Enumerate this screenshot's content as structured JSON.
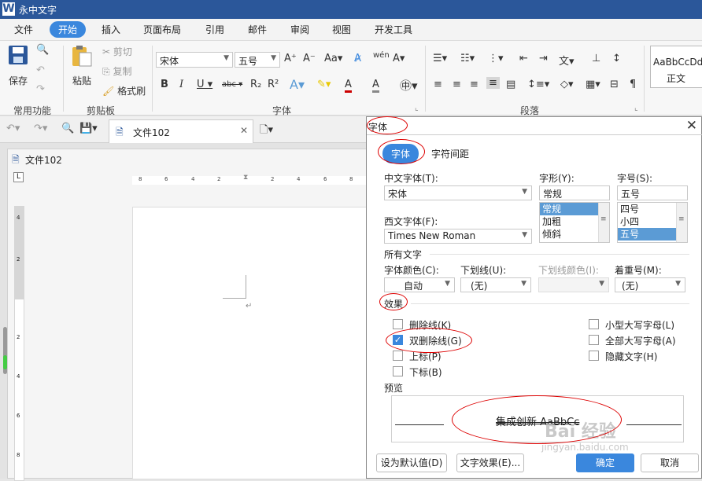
{
  "app": {
    "title": "永中文字",
    "logo": "W"
  },
  "menu": [
    "文件",
    "开始",
    "插入",
    "页面布局",
    "引用",
    "邮件",
    "审阅",
    "视图",
    "开发工具"
  ],
  "ribbon": {
    "save": "保存",
    "group_common": "常用功能",
    "paste": "粘贴",
    "cut": "剪切",
    "copy": "复制",
    "format_painter": "格式刷",
    "group_clipboard": "剪贴板",
    "font_name": "宋体",
    "font_size": "五号",
    "group_font": "字体",
    "group_paragraph": "段落",
    "style_sample": "AaBbCcDd",
    "style_name": "正文"
  },
  "doc": {
    "tab": "文件102",
    "area_title": "文件102",
    "ruler_h": [
      "8",
      "6",
      "4",
      "2",
      "2",
      "4",
      "6",
      "8"
    ],
    "ruler_v": [
      "4",
      "2",
      "2",
      "4",
      "6",
      "8"
    ]
  },
  "dialog": {
    "title": "字体",
    "tab_font": "字体",
    "tab_spacing": "字符间距",
    "cn_font_label": "中文字体(T):",
    "cn_font": "宋体",
    "style_label": "字形(Y):",
    "style_value": "常规",
    "style_list": [
      "常规",
      "加粗",
      "倾斜"
    ],
    "size_label": "字号(S):",
    "size_value": "五号",
    "size_list": [
      "四号",
      "小四",
      "五号"
    ],
    "west_font_label": "西文字体(F):",
    "west_font": "Times New Roman",
    "all_text": "所有文字",
    "color_label": "字体颜色(C):",
    "color_value": "自动",
    "underline_label": "下划线(U):",
    "underline_value": "(无)",
    "underline_color_label": "下划线颜色(I):",
    "emphasis_label": "着重号(M):",
    "emphasis_value": "(无)",
    "effects": "效果",
    "strike": "删除线(K)",
    "double_strike": "双删除线(G)",
    "superscript": "上标(P)",
    "subscript": "下标(B)",
    "small_caps": "小型大写字母(L)",
    "all_caps": "全部大写字母(A)",
    "hidden": "隐藏文字(H)",
    "preview_label": "预览",
    "preview_text": "集成创新 AaBbCc",
    "btn_default": "设为默认值(D)",
    "btn_effects": "文字效果(E)...",
    "btn_ok": "确定",
    "btn_cancel": "取消"
  },
  "watermark": {
    "main": "Bai 经验",
    "url": "jingyan.baidu.com"
  },
  "colors": {
    "brand": "#2b579a",
    "accent": "#3a87dd",
    "highlight": "#5b9bd5",
    "annotation": "#dd0000"
  }
}
